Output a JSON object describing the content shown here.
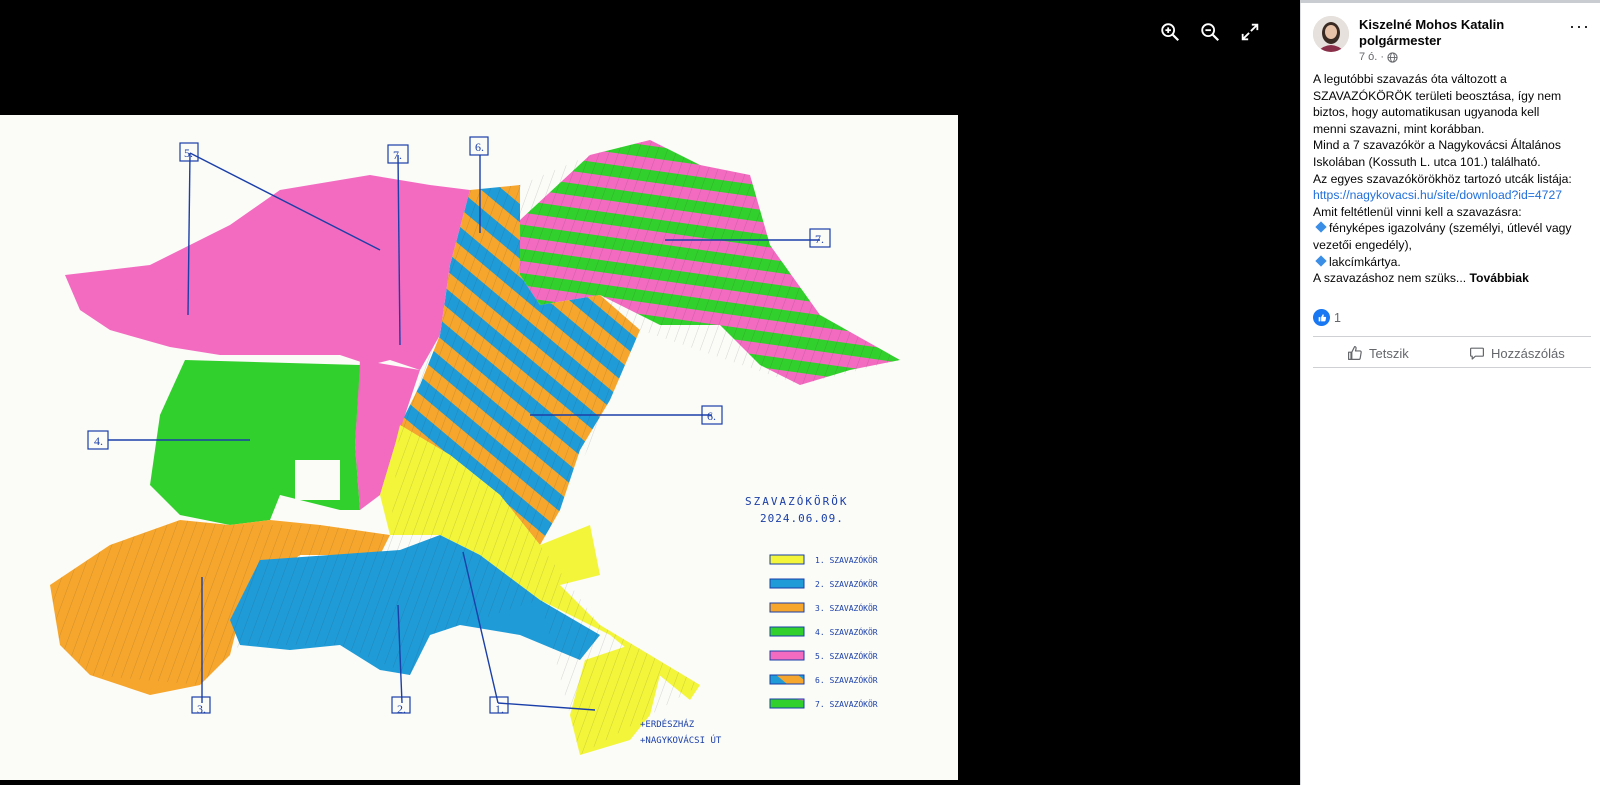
{
  "viewer": {
    "toolbar": [
      "zoom-in-icon",
      "zoom-out-icon",
      "fullscreen-icon"
    ],
    "photo": {
      "map_title": "SZAVAZÓKÖRÖK",
      "map_date": "2024.06.09.",
      "district_numbers": [
        "1.",
        "2.",
        "3.",
        "4.",
        "5.",
        "6.",
        "7.",
        "6.",
        "7."
      ],
      "legend": [
        "1. SZAVAZÓKÖR",
        "2. SZAVAZÓKÖR",
        "3. SZAVAZÓKÖR",
        "4. SZAVAZÓKÖR",
        "5. SZAVAZÓKÖR",
        "6. SZAVAZÓKÖR",
        "7. SZAVAZÓKÖR"
      ],
      "legend_colors": [
        "#f3f53a",
        "#1f9bd8",
        "#f6a62c",
        "#32d02c",
        "#f26bc0",
        "#f6a62c/#1f9bd8",
        "#f26bc0/#32d02c"
      ],
      "note_lines": [
        "+ERDÉSZHÁZ",
        "+NAGYKOVÁCSI ÚT"
      ]
    }
  },
  "post": {
    "author": "Kiszelné Mohos Katalin",
    "author_role": "polgármester",
    "time": "7 ó.",
    "privacy_icon": "globe-icon",
    "lines": [
      "A legutóbbi szavazás óta változott a",
      "SZAVAZÓKÖRÖK területi beosztása, így nem",
      "biztos, hogy automatikusan ugyanoda kell",
      "menni szavazni, mint korábban.",
      "Mind a 7 szavazókör a Nagykovácsi Általános",
      "Iskolában (Kossuth L. utca 101.) található.",
      "Az egyes szavazókörökhöz tartozó utcák listája:"
    ],
    "link": "https://nagykovacsi.hu/site/download?id=4727",
    "lines2": [
      "Amit feltétlenül vinni kell a szavazásra:"
    ],
    "bullet1": "fényképes igazolvány (személyi, útlevél vagy",
    "bullet1_cont": "vezetői engedély),",
    "bullet2": "lakcímkártya.",
    "truncated": "A szavazáshoz nem szüks...",
    "see_more": "Továbbiak",
    "reaction_count": "1",
    "like_label": "Tetszik",
    "comment_label": "Hozzászólás"
  }
}
